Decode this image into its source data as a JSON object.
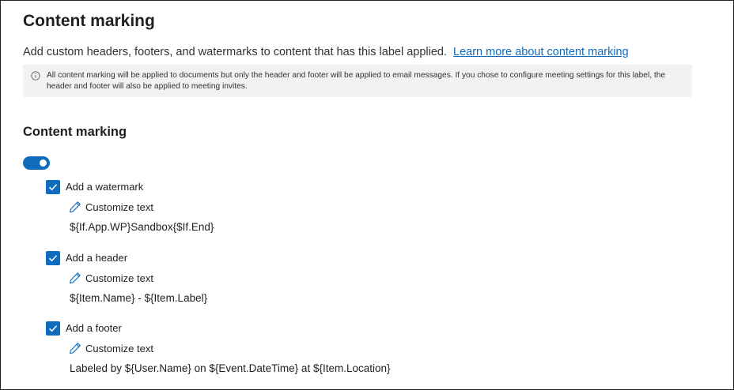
{
  "page": {
    "title": "Content marking",
    "description": "Add custom headers, footers, and watermarks to content that has this label applied.",
    "learn_more_link": "Learn more about content marking"
  },
  "info_bar": {
    "icon": "info-icon",
    "text": "All content marking will be applied to documents but only the header and footer will be applied to email messages. If you chose to configure meeting settings for this label, the header and footer will also be applied to meeting invites."
  },
  "section": {
    "title": "Content marking",
    "toggle_on": true
  },
  "markings": [
    {
      "label": "Add a watermark",
      "checked": true,
      "customize_label": "Customize text",
      "value": "${If.App.WP}Sandbox{$If.End}"
    },
    {
      "label": "Add a header",
      "checked": true,
      "customize_label": "Customize text",
      "value": "${Item.Name} - ${Item.Label}"
    },
    {
      "label": "Add a footer",
      "checked": true,
      "customize_label": "Customize text",
      "value": "Labeled by ${User.Name} on ${Event.DateTime} at ${Item.Location}"
    }
  ],
  "colors": {
    "accent": "#0f6cbd",
    "info_bg": "#f3f2f1",
    "text": "#201f1e"
  }
}
